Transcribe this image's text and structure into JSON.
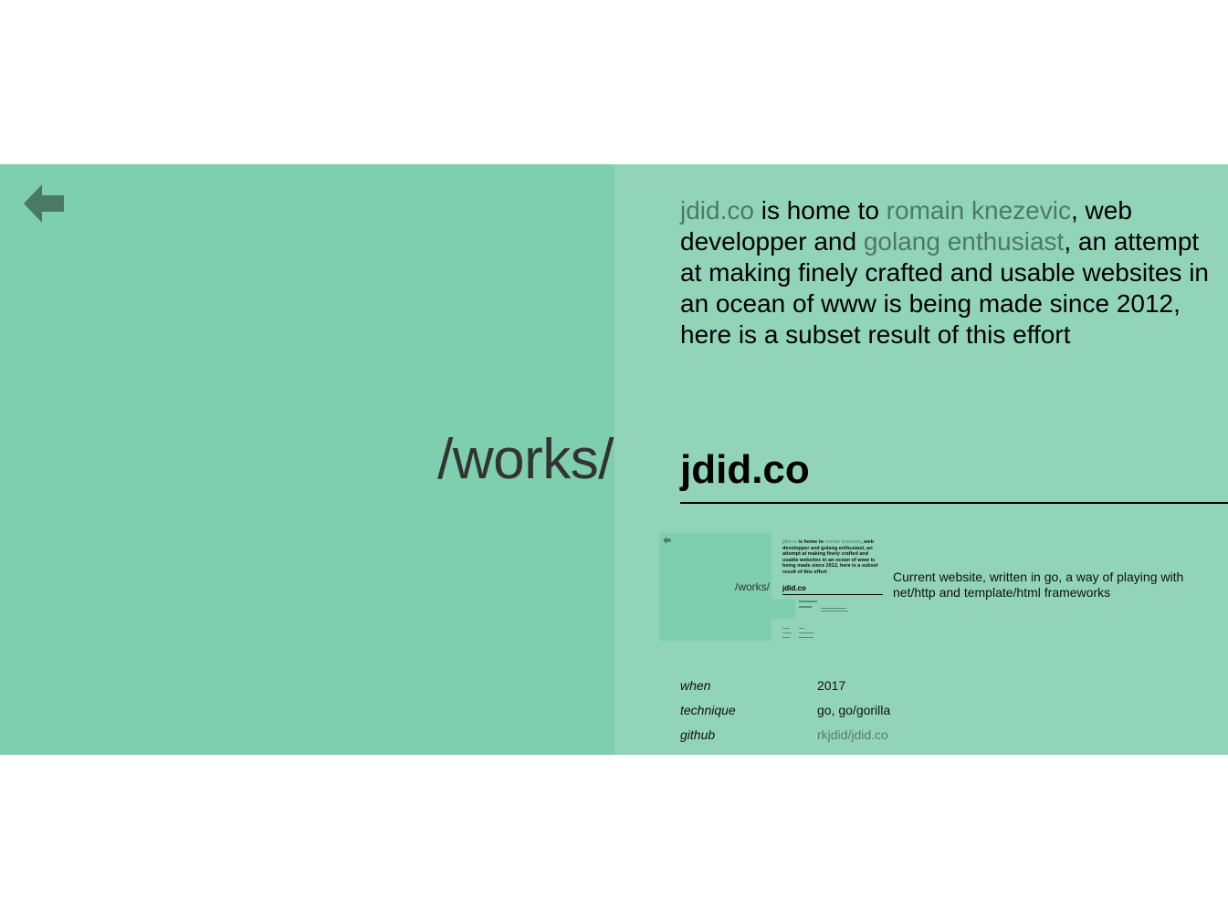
{
  "left": {
    "back_icon": "left-arrow-icon",
    "section_title": "/works/"
  },
  "intro": {
    "site_link": "jdid.co",
    "text1": " is home to ",
    "author_link": "romain knezevic",
    "text2": ", web developper and ",
    "golang_link": "golang enthusiast",
    "text3": ", an attempt at making finely crafted and usable websites in an ocean of www is being made since 2012, here is a subset result of this effort"
  },
  "project": {
    "title": "jdid.co",
    "description": "Current website, written in go, a way of playing with net/http and template/html frameworks",
    "meta": [
      {
        "key": "when",
        "value": "2017"
      },
      {
        "key": "technique",
        "value": "go, go/gorilla"
      },
      {
        "key": "github",
        "value": "rkjdid/jdid.co"
      }
    ]
  },
  "thumbnail": {
    "works": "/works/",
    "intro_site": "jdid.co",
    "intro_text": " is home to ",
    "intro_author": "romain knezevic",
    "intro_rest": ", web developper and golang enthusiast, an attempt at making finely crafted and usable websites in an ocean of www is being made since 2012, here is a subset result of this effort",
    "title": "jdid.co"
  },
  "colors": {
    "left_bg": "#7ecfaf",
    "right_bg": "#91d4b9",
    "link": "#4c7a67",
    "arrow": "#4a7a66"
  }
}
